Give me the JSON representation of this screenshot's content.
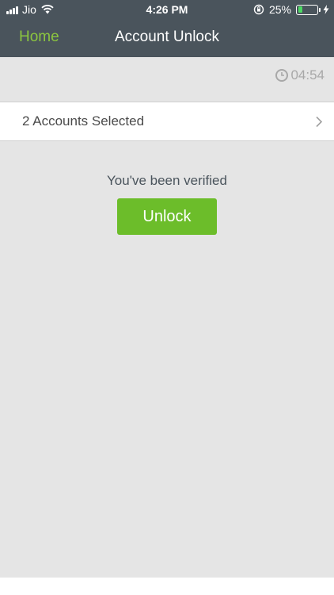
{
  "status_bar": {
    "carrier": "Jio",
    "time": "4:26 PM",
    "battery_percent": "25%",
    "battery_level": 0.25,
    "signal_icon": "signal-icon",
    "wifi_icon": "wifi-icon",
    "rotation_lock_icon": "rotation-lock-icon",
    "charging_icon": "bolt-icon"
  },
  "nav": {
    "back_label": "Home",
    "title": "Account Unlock"
  },
  "timer": {
    "value": "04:54",
    "icon": "clock-icon"
  },
  "accounts": {
    "label": "2 Accounts Selected",
    "icon": "chevron-right-icon"
  },
  "verification": {
    "message": "You've been verified",
    "button_label": "Unlock"
  },
  "colors": {
    "nav_background": "#4a545c",
    "accent_green": "#8cc63f",
    "button_green": "#6cbd2a",
    "page_background": "#e5e5e5"
  }
}
